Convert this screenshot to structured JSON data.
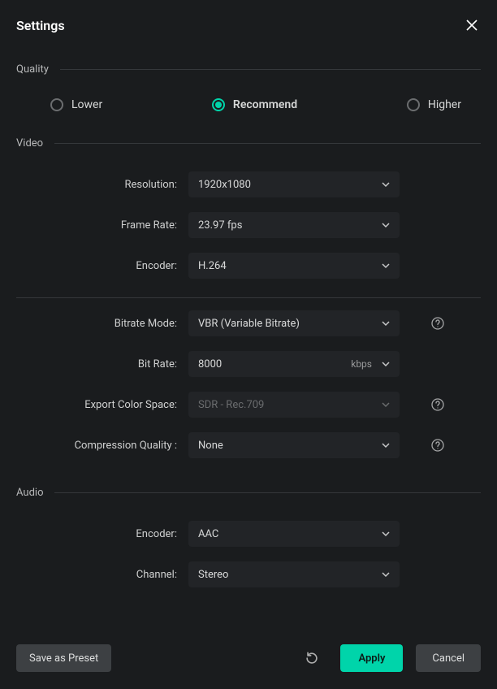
{
  "header": {
    "title": "Settings"
  },
  "quality": {
    "section": "Quality",
    "options": {
      "lower": "Lower",
      "recommend": "Recommend",
      "higher": "Higher"
    },
    "selected": "recommend"
  },
  "video": {
    "section": "Video",
    "resolution_label": "Resolution:",
    "resolution_value": "1920x1080",
    "framerate_label": "Frame Rate:",
    "framerate_value": "23.97 fps",
    "encoder_label": "Encoder:",
    "encoder_value": "H.264",
    "bitrate_mode_label": "Bitrate Mode:",
    "bitrate_mode_value": "VBR (Variable Bitrate)",
    "bitrate_label": "Bit Rate:",
    "bitrate_value": "8000",
    "bitrate_unit": "kbps",
    "colorspace_label": "Export Color Space:",
    "colorspace_value": "SDR - Rec.709",
    "compression_label": "Compression Quality :",
    "compression_value": "None"
  },
  "audio": {
    "section": "Audio",
    "encoder_label": "Encoder:",
    "encoder_value": "AAC",
    "channel_label": "Channel:",
    "channel_value": "Stereo"
  },
  "footer": {
    "save_preset": "Save as Preset",
    "apply": "Apply",
    "cancel": "Cancel"
  }
}
